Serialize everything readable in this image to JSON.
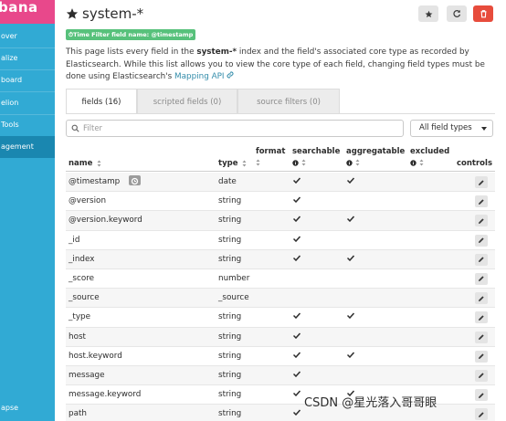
{
  "sidebar": {
    "brand": "bana",
    "items": [
      {
        "label": "over"
      },
      {
        "label": "alize"
      },
      {
        "label": "board"
      },
      {
        "label": "elion"
      },
      {
        "label": "Tools"
      },
      {
        "label": "agement",
        "active": true
      }
    ],
    "collapse_label": "apse"
  },
  "header": {
    "title": "system-*",
    "time_filter_badge": "Time Filter field name: @timestamp"
  },
  "description": {
    "part1": "This page lists every field in the ",
    "index_name": "system-*",
    "part2": " index and the field's associated core type as recorded by Elasticsearch. While this list allows you to view the core type of each field, changing field types must be done using Elasticsearch's ",
    "link_text": "Mapping API"
  },
  "tabs": [
    {
      "label": "fields (16)",
      "active": true
    },
    {
      "label": "scripted fields (0)",
      "active": false
    },
    {
      "label": "source filters (0)",
      "active": false
    }
  ],
  "filter": {
    "placeholder": "Filter",
    "type_select": "All field types"
  },
  "table": {
    "headers": {
      "name": "name",
      "type": "type",
      "format": "format",
      "searchable": "searchable",
      "aggregatable": "aggregatable",
      "excluded": "excluded",
      "controls": "controls"
    },
    "rows": [
      {
        "name": "@timestamp",
        "type": "date",
        "searchable": true,
        "aggregatable": true,
        "time_field": true
      },
      {
        "name": "@version",
        "type": "string",
        "searchable": true,
        "aggregatable": false
      },
      {
        "name": "@version.keyword",
        "type": "string",
        "searchable": true,
        "aggregatable": true
      },
      {
        "name": "_id",
        "type": "string",
        "searchable": true,
        "aggregatable": false
      },
      {
        "name": "_index",
        "type": "string",
        "searchable": true,
        "aggregatable": true
      },
      {
        "name": "_score",
        "type": "number",
        "searchable": false,
        "aggregatable": false
      },
      {
        "name": "_source",
        "type": "_source",
        "searchable": false,
        "aggregatable": false
      },
      {
        "name": "_type",
        "type": "string",
        "searchable": true,
        "aggregatable": true
      },
      {
        "name": "host",
        "type": "string",
        "searchable": true,
        "aggregatable": false
      },
      {
        "name": "host.keyword",
        "type": "string",
        "searchable": true,
        "aggregatable": true
      },
      {
        "name": "message",
        "type": "string",
        "searchable": true,
        "aggregatable": false
      },
      {
        "name": "message.keyword",
        "type": "string",
        "searchable": true,
        "aggregatable": true
      },
      {
        "name": "path",
        "type": "string",
        "searchable": true,
        "aggregatable": false
      }
    ]
  },
  "watermark": "CSDN @星光落入哥哥眼",
  "colors": {
    "sidebar": "#31aad4",
    "sidebar_active": "#1a87b0",
    "brand": "#e8488b",
    "badge": "#57c17b",
    "delete": "#e74c3c",
    "link": "#328caa"
  }
}
